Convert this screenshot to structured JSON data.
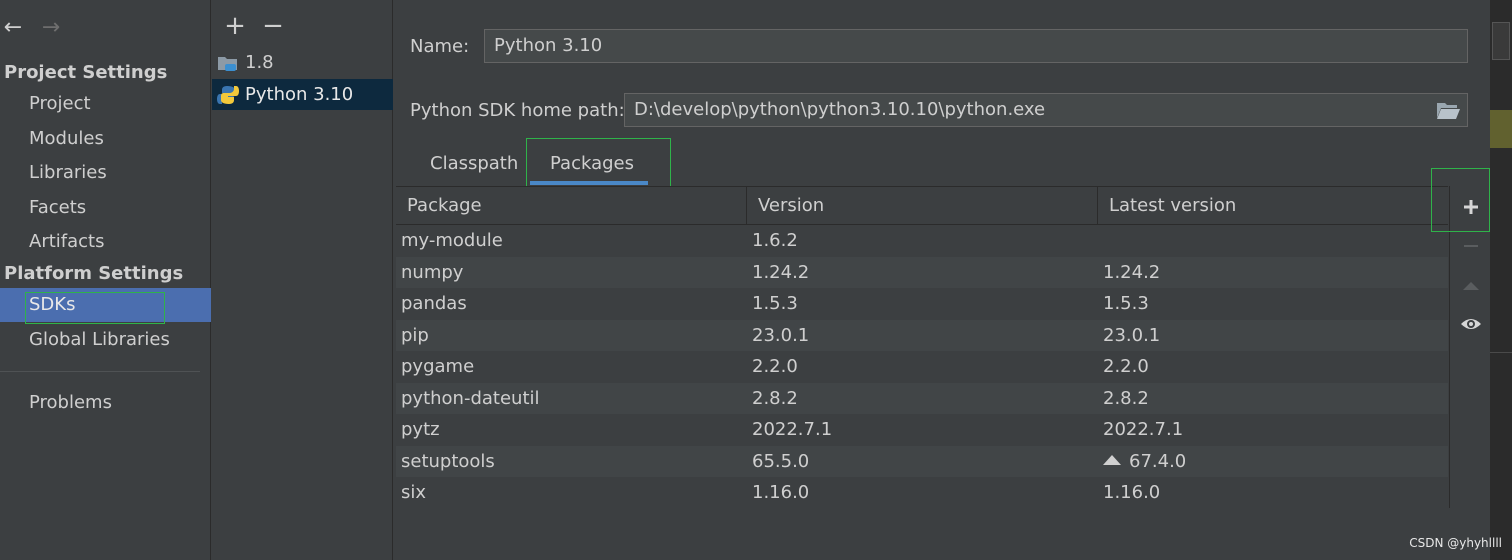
{
  "nav": {
    "back_icon": "arrow-left-icon",
    "forward_icon": "arrow-right-icon",
    "project_settings_title": "Project Settings",
    "project_items": [
      "Project",
      "Modules",
      "Libraries",
      "Facets",
      "Artifacts"
    ],
    "platform_settings_title": "Platform Settings",
    "platform_items": [
      "SDKs",
      "Global Libraries"
    ],
    "selected": "SDKs",
    "other_items": [
      "Problems"
    ]
  },
  "sdk_list": {
    "add_label": "+",
    "remove_label": "−",
    "items": [
      {
        "name": "1.8",
        "icon": "jdk-folder-icon"
      },
      {
        "name": "Python 3.10",
        "icon": "python-icon"
      }
    ],
    "selected": "Python 3.10"
  },
  "form": {
    "name_label": "Name:",
    "name_value": "Python 3.10",
    "home_path_label": "Python SDK home path:",
    "home_path_value": "D:\\develop\\python\\python3.10.10\\python.exe",
    "browse_icon": "folder-open-icon"
  },
  "tabs": {
    "classpath": "Classpath",
    "packages": "Packages",
    "active": "Packages"
  },
  "packages_table": {
    "columns": [
      "Package",
      "Version",
      "Latest version"
    ],
    "rows": [
      {
        "package": "my-module",
        "version": "1.6.2",
        "latest": "",
        "upgrade": false
      },
      {
        "package": "numpy",
        "version": "1.24.2",
        "latest": "1.24.2",
        "upgrade": false
      },
      {
        "package": "pandas",
        "version": "1.5.3",
        "latest": "1.5.3",
        "upgrade": false
      },
      {
        "package": "pip",
        "version": "23.0.1",
        "latest": "23.0.1",
        "upgrade": false
      },
      {
        "package": "pygame",
        "version": "2.2.0",
        "latest": "2.2.0",
        "upgrade": false
      },
      {
        "package": "python-dateutil",
        "version": "2.8.2",
        "latest": "2.8.2",
        "upgrade": false
      },
      {
        "package": "pytz",
        "version": "2022.7.1",
        "latest": "2022.7.1",
        "upgrade": false
      },
      {
        "package": "setuptools",
        "version": "65.5.0",
        "latest": "67.4.0",
        "upgrade": true
      },
      {
        "package": "six",
        "version": "1.16.0",
        "latest": "1.16.0",
        "upgrade": false
      }
    ]
  },
  "side_toolbar": [
    "plus-icon",
    "minus-icon",
    "upgrade-triangle-icon",
    "eye-icon"
  ],
  "highlight_color": "#2fb34a",
  "watermark": "CSDN @yhyhllll"
}
